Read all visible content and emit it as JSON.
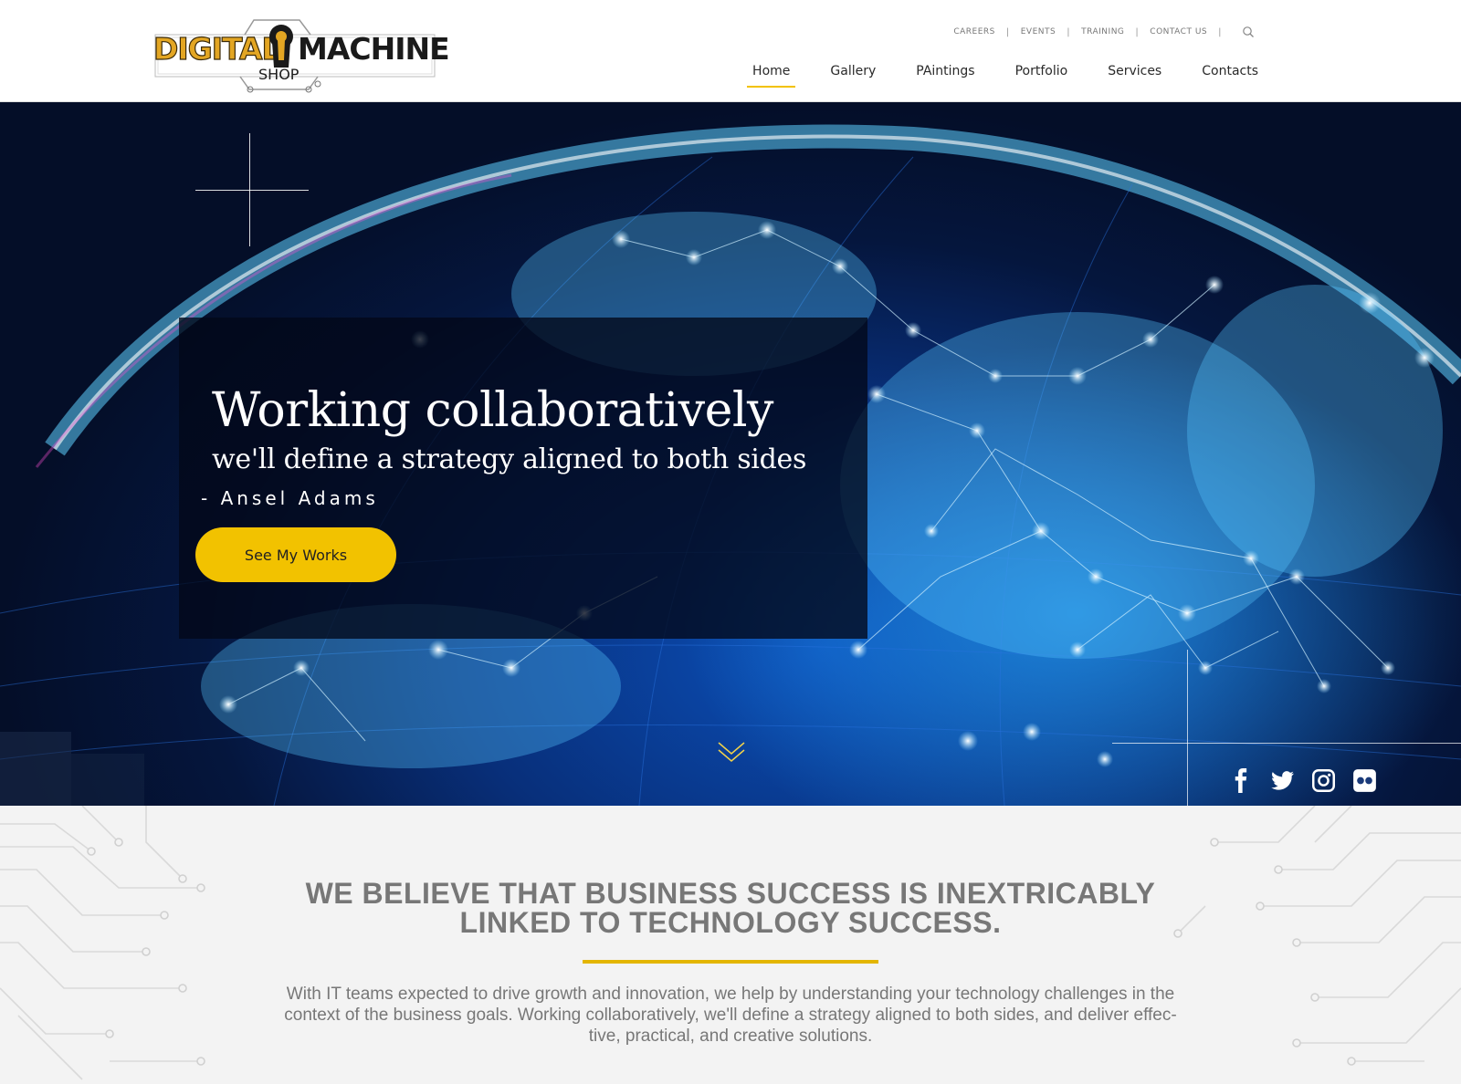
{
  "brand": {
    "logo_left": "DIGITAL",
    "logo_right": "MACHINE",
    "logo_sub": "SHOP",
    "colors": {
      "accent": "#f2c200",
      "logo_gold": "#e3a623"
    }
  },
  "utility_nav": {
    "items": [
      "CAREERS",
      "EVENTS",
      "TRAINING",
      "CONTACT US"
    ],
    "separator": "|",
    "search_icon": "search-icon"
  },
  "main_nav": {
    "items": [
      "Home",
      "Gallery",
      "PAintings",
      "Portfolio",
      "Services",
      "Contacts"
    ],
    "active": "Home"
  },
  "hero": {
    "title": "Working collaboratively",
    "subtitle": "we'll define a strategy aligned to both sides",
    "author": "- Ansel Adams",
    "button_label": "See My Works",
    "scroll_icon": "chevron-double-down-icon",
    "social": [
      "facebook-icon",
      "twitter-icon",
      "instagram-icon",
      "flickr-icon"
    ]
  },
  "about": {
    "heading_line1": "WE BELIEVE THAT BUSINESS SUCCESS IS INEXTRICABLY",
    "heading_line2": "LINKED TO TECHNOLOGY SUCCESS.",
    "body_line1": "With IT teams expected to drive growth and innovation, we help by understanding your technology challenges in the",
    "body_line2": "context of the business goals. Working collaboratively, we'll define a strategy aligned to both sides, and deliver effec-",
    "body_line3": "tive, practical, and creative solutions."
  }
}
